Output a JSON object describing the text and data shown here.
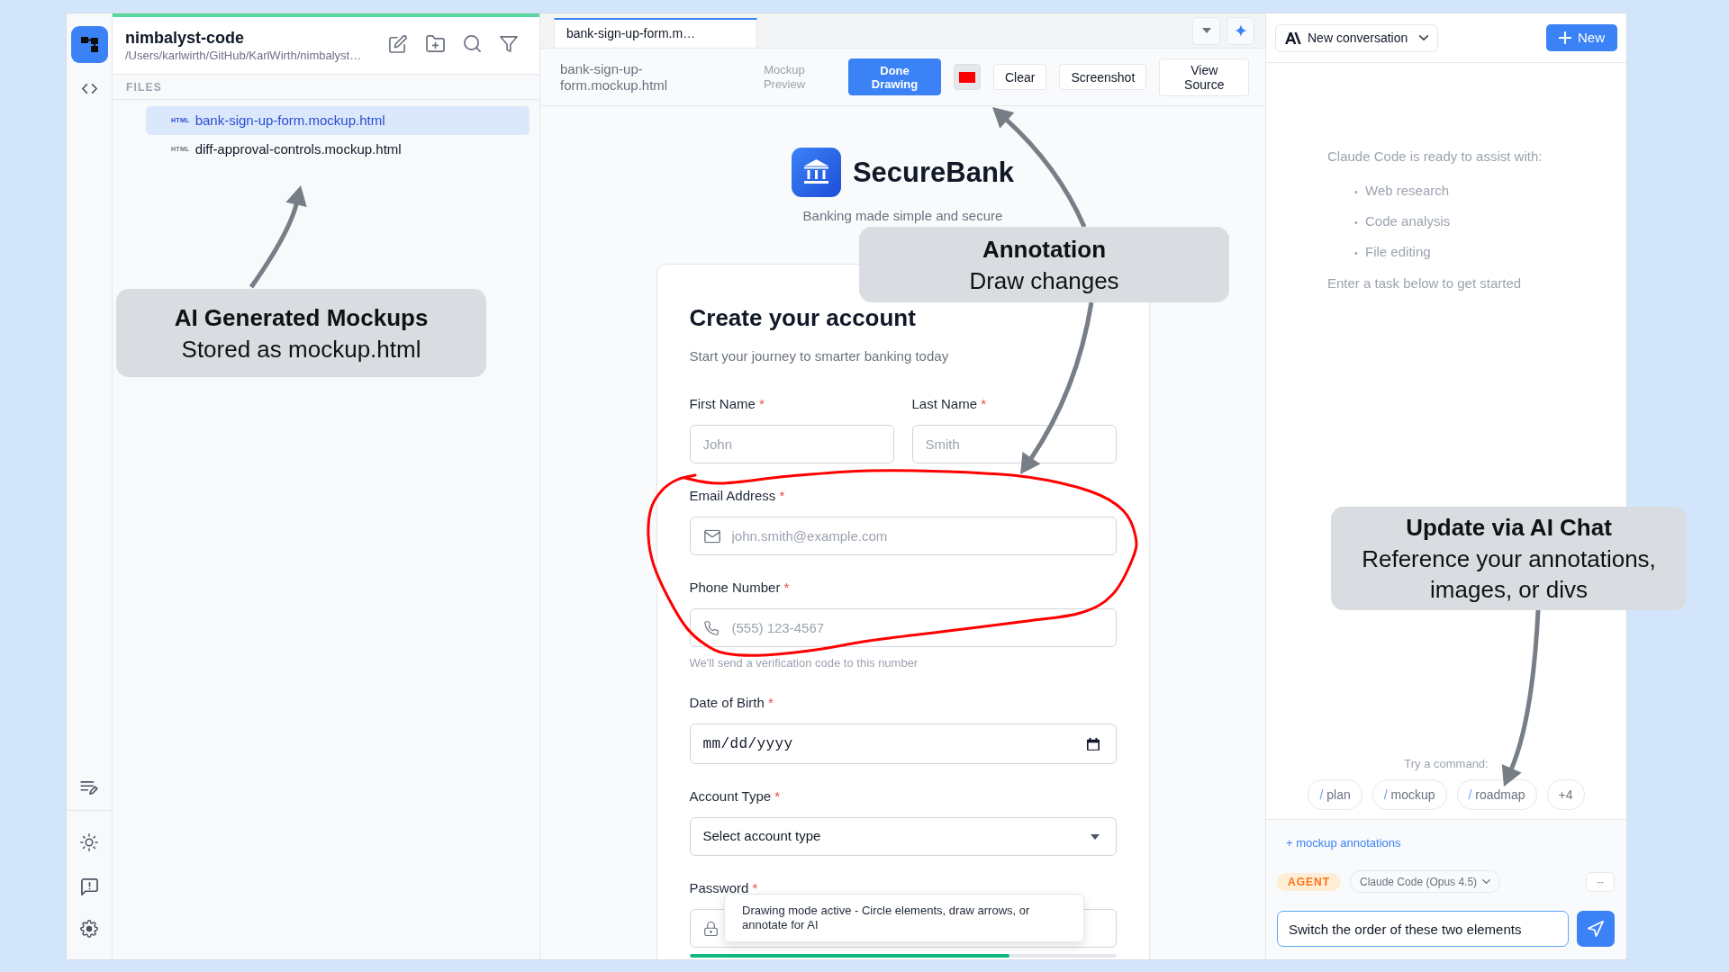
{
  "file_panel": {
    "title": "nimbalyst-code",
    "path": "/Users/karlwirth/GitHub/KarlWirth/nimbalyst…",
    "section": "FILES",
    "files": [
      {
        "type_label": "HTML",
        "name": "bank-sign-up-form.mockup.html",
        "selected": true
      },
      {
        "type_label": "HTML",
        "name": "diff-approval-controls.mockup.html",
        "selected": false
      }
    ]
  },
  "editor": {
    "tabs": [
      {
        "label": "bank-sign-up-form.m…",
        "selected": true
      }
    ],
    "toolbar": {
      "file_name": "bank-sign-up-form.mockup.html",
      "mode": "Mockup Preview",
      "buttons": [
        {
          "kind": "primary",
          "label": "Done Drawing"
        },
        {
          "kind": "swatch",
          "color": "#ff0000"
        },
        {
          "kind": "plain",
          "label": "Clear"
        },
        {
          "kind": "plain",
          "label": "Screenshot"
        },
        {
          "kind": "plain",
          "label": "View Source"
        }
      ]
    },
    "preview": {
      "brand": "SecureBank",
      "tagline": "Banking made simple and secure",
      "form": {
        "title": "Create your account",
        "subtitle": "Start your journey to smarter banking today",
        "rows": [
          {
            "fields": [
              {
                "kind": "text",
                "label": "First Name",
                "required_mark": "*",
                "placeholder": "John"
              },
              {
                "kind": "text",
                "label": "Last Name",
                "required_mark": "*",
                "placeholder": "Smith"
              }
            ]
          },
          {
            "fields": [
              {
                "kind": "email",
                "label": "Email Address",
                "required_mark": "*",
                "placeholder": "john.smith@example.com"
              }
            ]
          },
          {
            "fields": [
              {
                "kind": "phone",
                "label": "Phone Number",
                "required_mark": "*",
                "placeholder": "(555) 123-4567",
                "hint": "We'll send a verification code to this number"
              }
            ]
          },
          {
            "fields": [
              {
                "kind": "date",
                "label": "Date of Birth",
                "required_mark": "*",
                "placeholder": "mm/dd/yyyy"
              }
            ]
          },
          {
            "fields": [
              {
                "kind": "select",
                "label": "Account Type",
                "required_mark": "*",
                "value": "Select account type"
              }
            ]
          },
          {
            "fields": [
              {
                "kind": "password",
                "label": "Password",
                "required_mark": "*",
                "level": 0.75
              }
            ]
          }
        ]
      },
      "tooltip": "Drawing mode active - Circle elements, draw arrows, or annotate for AI"
    }
  },
  "chat": {
    "conversation": "New conversation",
    "new_button": "New",
    "intro": "Claude Code is ready to assist with:",
    "capabilities": [
      {
        "marker": "•",
        "label": "Web research"
      },
      {
        "marker": "•",
        "label": "Code analysis"
      },
      {
        "marker": "•",
        "label": "File editing"
      }
    ],
    "prompt": "Enter a task below to get started",
    "commands_label": "Try a command:",
    "commands": [
      {
        "kind": "command",
        "prefix": "/",
        "name": "plan"
      },
      {
        "kind": "command",
        "prefix": "/",
        "name": "mockup"
      },
      {
        "kind": "command",
        "prefix": "/",
        "name": "roadmap"
      },
      {
        "kind": "more",
        "name": "+4"
      }
    ],
    "attachment": "+ mockup annotations",
    "mode": "AGENT",
    "model": "Claude Code (Opus 4.5)",
    "context": "--",
    "input": {
      "value": "Switch the order of these two elements"
    }
  },
  "callouts": [
    {
      "title": "AI Generated Mockups",
      "text": "Stored as mockup.html"
    },
    {
      "title": "Annotation",
      "text": "Draw changes"
    },
    {
      "title": "Update via AI Chat",
      "text": "Reference your annotations, images, or divs"
    }
  ]
}
